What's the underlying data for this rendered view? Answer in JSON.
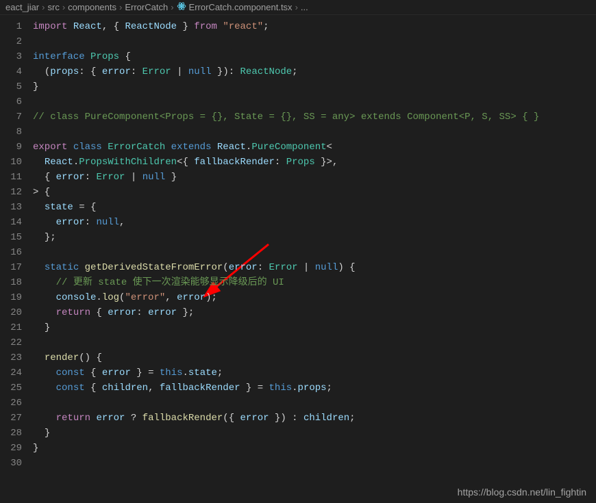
{
  "breadcrumb": {
    "parts": [
      "eact_jiar",
      "src",
      "components",
      "ErrorCatch",
      "ErrorCatch.component.tsx",
      "..."
    ],
    "sep": "›",
    "icon": "react-icon"
  },
  "watermark": "https://blog.csdn.net/lin_fightin",
  "code": {
    "lines": [
      {
        "n": 1,
        "tokens": [
          [
            "keyword2",
            "import"
          ],
          [
            "punc",
            " "
          ],
          [
            "var",
            "React"
          ],
          [
            "punc",
            ", { "
          ],
          [
            "var",
            "ReactNode"
          ],
          [
            "punc",
            " } "
          ],
          [
            "keyword2",
            "from"
          ],
          [
            "punc",
            " "
          ],
          [
            "string",
            "\"react\""
          ],
          [
            "punc",
            ";"
          ]
        ]
      },
      {
        "n": 2,
        "tokens": []
      },
      {
        "n": 3,
        "tokens": [
          [
            "keyword",
            "interface"
          ],
          [
            "punc",
            " "
          ],
          [
            "type",
            "Props"
          ],
          [
            "punc",
            " {"
          ]
        ]
      },
      {
        "n": 4,
        "indent": 1,
        "tokens": [
          [
            "punc",
            "("
          ],
          [
            "var",
            "props"
          ],
          [
            "punc",
            ": { "
          ],
          [
            "var",
            "error"
          ],
          [
            "punc",
            ": "
          ],
          [
            "type",
            "Error"
          ],
          [
            "punc",
            " | "
          ],
          [
            "const",
            "null"
          ],
          [
            "punc",
            " }): "
          ],
          [
            "type",
            "ReactNode"
          ],
          [
            "punc",
            ";"
          ]
        ]
      },
      {
        "n": 5,
        "tokens": [
          [
            "punc",
            "}"
          ]
        ]
      },
      {
        "n": 6,
        "tokens": []
      },
      {
        "n": 7,
        "tokens": [
          [
            "comment",
            "// class PureComponent<Props = {}, State = {}, SS = any> extends Component<P, S, SS> { }"
          ]
        ]
      },
      {
        "n": 8,
        "tokens": []
      },
      {
        "n": 9,
        "tokens": [
          [
            "keyword2",
            "export"
          ],
          [
            "punc",
            " "
          ],
          [
            "keyword",
            "class"
          ],
          [
            "punc",
            " "
          ],
          [
            "type",
            "ErrorCatch"
          ],
          [
            "punc",
            " "
          ],
          [
            "keyword",
            "extends"
          ],
          [
            "punc",
            " "
          ],
          [
            "var",
            "React"
          ],
          [
            "punc",
            "."
          ],
          [
            "type",
            "PureComponent"
          ],
          [
            "punc",
            "<"
          ]
        ]
      },
      {
        "n": 10,
        "indent": 1,
        "tokens": [
          [
            "var",
            "React"
          ],
          [
            "punc",
            "."
          ],
          [
            "type",
            "PropsWithChildren"
          ],
          [
            "punc",
            "<{ "
          ],
          [
            "var",
            "fallbackRender"
          ],
          [
            "punc",
            ": "
          ],
          [
            "type",
            "Props"
          ],
          [
            "punc",
            " }>,"
          ]
        ]
      },
      {
        "n": 11,
        "indent": 1,
        "tokens": [
          [
            "punc",
            "{ "
          ],
          [
            "var",
            "error"
          ],
          [
            "punc",
            ": "
          ],
          [
            "type",
            "Error"
          ],
          [
            "punc",
            " | "
          ],
          [
            "const",
            "null"
          ],
          [
            "punc",
            " }"
          ]
        ]
      },
      {
        "n": 12,
        "tokens": [
          [
            "punc",
            "> {"
          ]
        ]
      },
      {
        "n": 13,
        "indent": 1,
        "tokens": [
          [
            "var",
            "state"
          ],
          [
            "punc",
            " = {"
          ]
        ]
      },
      {
        "n": 14,
        "indent": 2,
        "tokens": [
          [
            "var",
            "error"
          ],
          [
            "punc",
            ": "
          ],
          [
            "const",
            "null"
          ],
          [
            "punc",
            ","
          ]
        ]
      },
      {
        "n": 15,
        "indent": 1,
        "tokens": [
          [
            "punc",
            "};"
          ]
        ]
      },
      {
        "n": 16,
        "tokens": []
      },
      {
        "n": 17,
        "indent": 1,
        "tokens": [
          [
            "keyword",
            "static"
          ],
          [
            "punc",
            " "
          ],
          [
            "func",
            "getDerivedStateFromError"
          ],
          [
            "punc",
            "("
          ],
          [
            "var",
            "error"
          ],
          [
            "punc",
            ": "
          ],
          [
            "type",
            "Error"
          ],
          [
            "punc",
            " | "
          ],
          [
            "const",
            "null"
          ],
          [
            "punc",
            ") {"
          ]
        ]
      },
      {
        "n": 18,
        "indent": 2,
        "tokens": [
          [
            "comment",
            "// 更新 state 使下一次渲染能够显示降级后的 UI"
          ]
        ]
      },
      {
        "n": 19,
        "indent": 2,
        "tokens": [
          [
            "var",
            "console"
          ],
          [
            "punc",
            "."
          ],
          [
            "func",
            "log"
          ],
          [
            "punc",
            "("
          ],
          [
            "string",
            "\"error\""
          ],
          [
            "punc",
            ", "
          ],
          [
            "var",
            "error"
          ],
          [
            "punc",
            ");"
          ]
        ]
      },
      {
        "n": 20,
        "indent": 2,
        "tokens": [
          [
            "keyword2",
            "return"
          ],
          [
            "punc",
            " { "
          ],
          [
            "var",
            "error"
          ],
          [
            "punc",
            ": "
          ],
          [
            "var",
            "error"
          ],
          [
            "punc",
            " };"
          ]
        ]
      },
      {
        "n": 21,
        "indent": 1,
        "tokens": [
          [
            "punc",
            "}"
          ]
        ]
      },
      {
        "n": 22,
        "tokens": []
      },
      {
        "n": 23,
        "indent": 1,
        "tokens": [
          [
            "func",
            "render"
          ],
          [
            "punc",
            "() {"
          ]
        ]
      },
      {
        "n": 24,
        "indent": 2,
        "tokens": [
          [
            "keyword",
            "const"
          ],
          [
            "punc",
            " { "
          ],
          [
            "var",
            "error"
          ],
          [
            "punc",
            " } = "
          ],
          [
            "keyword",
            "this"
          ],
          [
            "punc",
            "."
          ],
          [
            "var",
            "state"
          ],
          [
            "punc",
            ";"
          ]
        ]
      },
      {
        "n": 25,
        "indent": 2,
        "tokens": [
          [
            "keyword",
            "const"
          ],
          [
            "punc",
            " { "
          ],
          [
            "var",
            "children"
          ],
          [
            "punc",
            ", "
          ],
          [
            "var",
            "fallbackRender"
          ],
          [
            "punc",
            " } = "
          ],
          [
            "keyword",
            "this"
          ],
          [
            "punc",
            "."
          ],
          [
            "var",
            "props"
          ],
          [
            "punc",
            ";"
          ]
        ]
      },
      {
        "n": 26,
        "tokens": []
      },
      {
        "n": 27,
        "indent": 2,
        "tokens": [
          [
            "keyword2",
            "return"
          ],
          [
            "punc",
            " "
          ],
          [
            "var",
            "error"
          ],
          [
            "punc",
            " ? "
          ],
          [
            "func",
            "fallbackRender"
          ],
          [
            "punc",
            "({ "
          ],
          [
            "var",
            "error"
          ],
          [
            "punc",
            " }) : "
          ],
          [
            "var",
            "children"
          ],
          [
            "punc",
            ";"
          ]
        ]
      },
      {
        "n": 28,
        "indent": 1,
        "tokens": [
          [
            "punc",
            "}"
          ]
        ]
      },
      {
        "n": 29,
        "tokens": [
          [
            "punc",
            "}"
          ]
        ]
      },
      {
        "n": 30,
        "tokens": []
      }
    ]
  }
}
